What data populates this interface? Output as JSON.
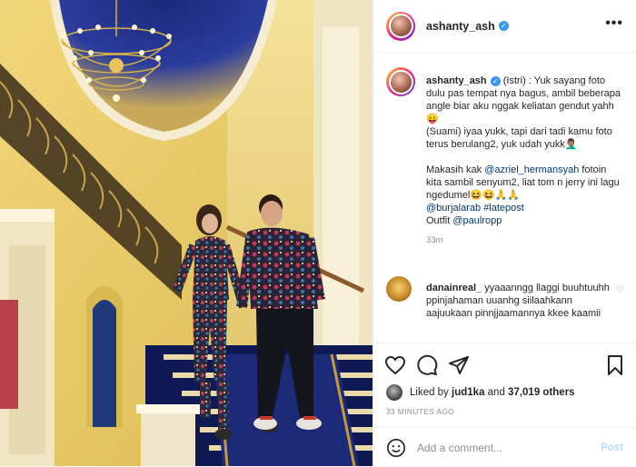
{
  "post": {
    "username": "ashanty_ash",
    "more_label": "•••"
  },
  "caption": {
    "username": "ashanty_ash",
    "lines": [
      "(Istri) : Yuk sayang foto dulu pas tempat nya bagus, ambil beberapa angle biar aku nggak keliatan gendut yahh😛",
      "(Suami) iyaa yukk, tapi dari tadi kamu foto terus berulang2, yuk udah yukk🤦🏽‍♂️"
    ],
    "thanks_prefix": "Makasih kak ",
    "mention_1": "@azriel_hermansyah",
    "thanks_suffix": " fotoin kita sambil senyum2, liat tom n jerry ini lagu ngedumel😆😆🙏🙏",
    "mention_2": "@burjalarab",
    "hashtag": "#latepost",
    "outfit_prefix": "Outfit ",
    "mention_3": "@paulropp",
    "time": "33m"
  },
  "comment": {
    "username": "danainreal_",
    "text": " yyaaanngg llaggi buuhtuuhh ppinjahaman uuanhg siilaahkann aajuukaan pinnjjaamannya kkee kaamii"
  },
  "actions": {
    "liked_by": "jud1ka",
    "likes_count": "37,019 others",
    "time_ago": "33 MINUTES AGO",
    "comment_placeholder": "Add a comment...",
    "post_label": "Post"
  }
}
